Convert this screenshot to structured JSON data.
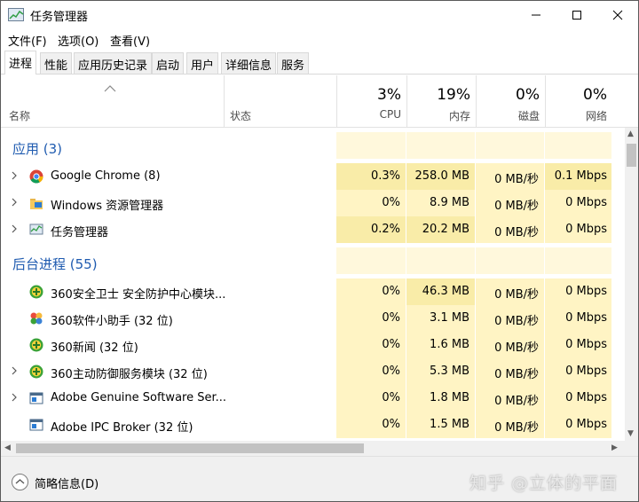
{
  "window": {
    "title": "任务管理器"
  },
  "menu": [
    "文件(F)",
    "选项(O)",
    "查看(V)"
  ],
  "tabs": [
    "进程",
    "性能",
    "应用历史记录",
    "启动",
    "用户",
    "详细信息",
    "服务"
  ],
  "header": {
    "name": "名称",
    "status": "状态",
    "cpu": {
      "pct": "3%",
      "label": "CPU"
    },
    "mem": {
      "pct": "19%",
      "label": "内存"
    },
    "disk": {
      "pct": "0%",
      "label": "磁盘"
    },
    "net": {
      "pct": "0%",
      "label": "网络"
    }
  },
  "groups": {
    "apps": "应用 (3)",
    "background": "后台进程 (55)"
  },
  "apps": [
    {
      "name": "Google Chrome (8)",
      "cpu": "0.3%",
      "mem": "258.0 MB",
      "disk": "0 MB/秒",
      "net": "0.1 Mbps",
      "icon": "chrome-icon"
    },
    {
      "name": "Windows 资源管理器",
      "cpu": "0%",
      "mem": "8.9 MB",
      "disk": "0 MB/秒",
      "net": "0 Mbps",
      "icon": "folder-icon"
    },
    {
      "name": "任务管理器",
      "cpu": "0.2%",
      "mem": "20.2 MB",
      "disk": "0 MB/秒",
      "net": "0 Mbps",
      "icon": "task-manager-icon"
    }
  ],
  "background": [
    {
      "name": "360安全卫士 安全防护中心模块...",
      "cpu": "0%",
      "mem": "46.3 MB",
      "disk": "0 MB/秒",
      "net": "0 Mbps",
      "icon": "360-shield-icon"
    },
    {
      "name": "360软件小助手 (32 位)",
      "cpu": "0%",
      "mem": "3.1 MB",
      "disk": "0 MB/秒",
      "net": "0 Mbps",
      "icon": "360-assistant-icon"
    },
    {
      "name": "360新闻 (32 位)",
      "cpu": "0%",
      "mem": "1.6 MB",
      "disk": "0 MB/秒",
      "net": "0 Mbps",
      "icon": "360-shield-icon"
    },
    {
      "name": "360主动防御服务模块 (32 位)",
      "cpu": "0%",
      "mem": "5.3 MB",
      "disk": "0 MB/秒",
      "net": "0 Mbps",
      "icon": "360-shield-icon"
    },
    {
      "name": "Adobe Genuine Software Ser...",
      "cpu": "0%",
      "mem": "1.8 MB",
      "disk": "0 MB/秒",
      "net": "0 Mbps",
      "icon": "app-window-icon"
    },
    {
      "name": "Adobe IPC Broker (32 位)",
      "cpu": "0%",
      "mem": "1.5 MB",
      "disk": "0 MB/秒",
      "net": "0 Mbps",
      "icon": "app-window-icon"
    }
  ],
  "footer": {
    "fewer_details": "简略信息(D)",
    "watermark": "知乎 @立体的平面"
  },
  "colors": {
    "heat_light": "#fff4c4",
    "heat_mid": "#f9eca8",
    "group_title": "#1f5bb0"
  }
}
